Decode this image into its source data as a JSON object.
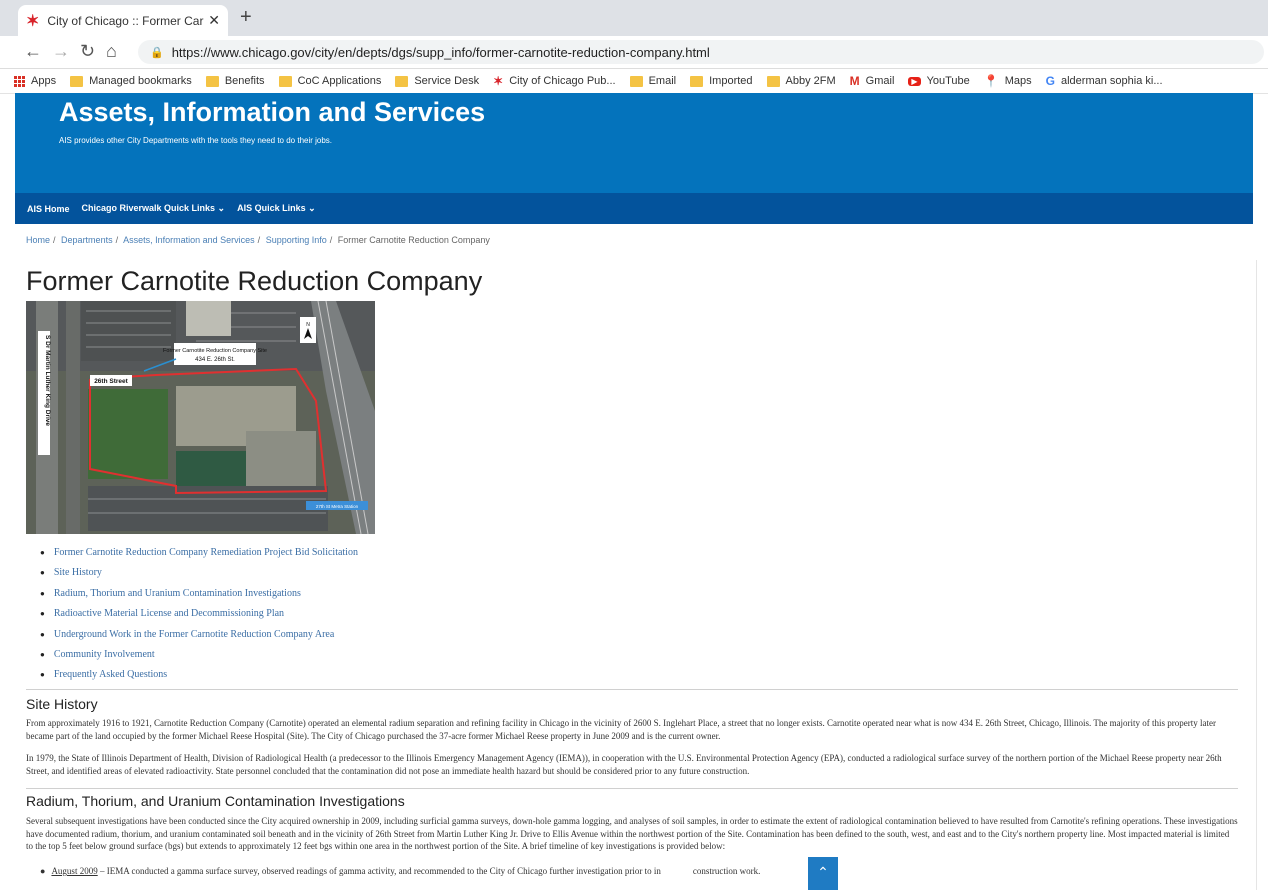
{
  "browser": {
    "tab_title": "City of Chicago :: Former Carnoti",
    "url": "https://www.chicago.gov/city/en/depts/dgs/supp_info/former-carnotite-reduction-company.html",
    "bookmarks": [
      "Apps",
      "Managed bookmarks",
      "Benefits",
      "CoC Applications",
      "Service Desk",
      "City of Chicago Pub...",
      "Email",
      "Imported",
      "Abby 2FM",
      "Gmail",
      "YouTube",
      "Maps",
      "alderman sophia ki..."
    ]
  },
  "header": {
    "title": "Assets, Information and Services",
    "subtitle": "AIS provides other City Departments with the tools they need to do their jobs."
  },
  "nav": {
    "items": [
      "AIS Home",
      "Chicago Riverwalk Quick Links ⌄",
      "AIS Quick Links ⌄"
    ]
  },
  "breadcrumb": [
    "Home",
    "Departments",
    "Assets, Information and Services",
    "Supporting Info",
    "Former Carnotite Reduction Company"
  ],
  "page_title": "Former Carnotite Reduction Company",
  "map": {
    "site_label_1": "Former Carnotite Reduction Company Site",
    "site_label_2": "434 E. 26th St.",
    "street_26th": "26th Street",
    "street_mlk": "S Dr Martin Luther King Drive",
    "north": "N",
    "bottom_label": "27th St Metra Station"
  },
  "links": [
    "Former Carnotite Reduction Company Remediation Project Bid Solicitation",
    "Site History",
    "Radium, Thorium and Uranium Contamination Investigations",
    "Radioactive Material License and Decommissioning Plan",
    "Underground Work in the Former Carnotite Reduction Company Area",
    "Community Involvement",
    "Frequently Asked Questions"
  ],
  "site_history": {
    "heading": "Site History",
    "p1": "From approximately 1916 to 1921, Carnotite Reduction Company (Carnotite) operated an elemental radium separation and refining facility in Chicago in the vicinity of 2600 S. Inglehart Place, a street that no longer exists. Carnotite operated near what is now 434 E. 26th Street, Chicago, Illinois. The majority of this property later became part of the land occupied by the former Michael Reese Hospital (Site). The City of Chicago purchased the 37-acre former Michael Reese property in June 2009 and is the current owner.",
    "p2": "In 1979, the State of Illinois Department of Health, Division of Radiological Health (a predecessor to the Illinois Emergency Management Agency (IEMA)), in cooperation with the U.S. Environmental Protection Agency (EPA), conducted a radiological surface survey of the northern portion of the Michael Reese property near 26th Street, and identified areas of elevated radioactivity. State personnel concluded that the contamination did not pose an immediate health hazard but should be considered prior to any future construction."
  },
  "investigations": {
    "heading": "Radium, Thorium, and Uranium Contamination Investigations",
    "p1": "Several subsequent investigations have been conducted since the City acquired ownership in 2009, including surficial gamma surveys, down-hole gamma logging, and analyses of soil samples, in order to estimate the extent of radiological contamination believed to have resulted from Carnotite's refining operations. These investigations have documented radium, thorium, and uranium contaminated soil beneath and in the vicinity of 26th Street from Martin Luther King Jr. Drive to Ellis Avenue within the northwest portion of the Site. Contamination has been defined to the south, west, and east and to the City's northern property line. Most impacted material is limited to the top 5 feet below ground surface (bgs) but extends to approximately 12 feet bgs within one area in the northwest portion of the Site. A brief timeline of key investigations is provided below:",
    "timeline_date": "August 2009",
    "timeline_text_a": " – IEMA conducted a gamma surface survey, observed readings of gamma activity, and recommended to the City of Chicago further investigation prior to in",
    "timeline_text_b": "construction work."
  }
}
